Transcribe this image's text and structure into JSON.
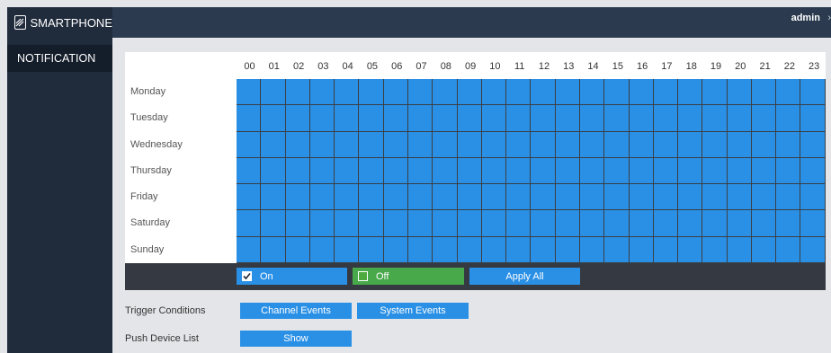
{
  "sidebar": {
    "brand": "SMARTPHONE",
    "items": [
      {
        "label": "NOTIFICATION"
      }
    ]
  },
  "topbar": {
    "user": "admin"
  },
  "schedule": {
    "hours": [
      "00",
      "01",
      "02",
      "03",
      "04",
      "05",
      "06",
      "07",
      "08",
      "09",
      "10",
      "11",
      "12",
      "13",
      "14",
      "15",
      "16",
      "17",
      "18",
      "19",
      "20",
      "21",
      "22",
      "23"
    ],
    "days": [
      "Monday",
      "Tuesday",
      "Wednesday",
      "Thursday",
      "Friday",
      "Saturday",
      "Sunday"
    ],
    "all_on": true,
    "on_label": "On",
    "off_label": "Off",
    "apply_all_label": "Apply All"
  },
  "trigger": {
    "label": "Trigger Conditions",
    "channel_events": "Channel Events",
    "system_events": "System Events"
  },
  "push": {
    "label": "Push Device List",
    "show": "Show"
  },
  "colors": {
    "on": "#2a90e6",
    "off": "#47a94a",
    "sidebar": "#202b3c",
    "topbar": "#2b3a4f"
  }
}
